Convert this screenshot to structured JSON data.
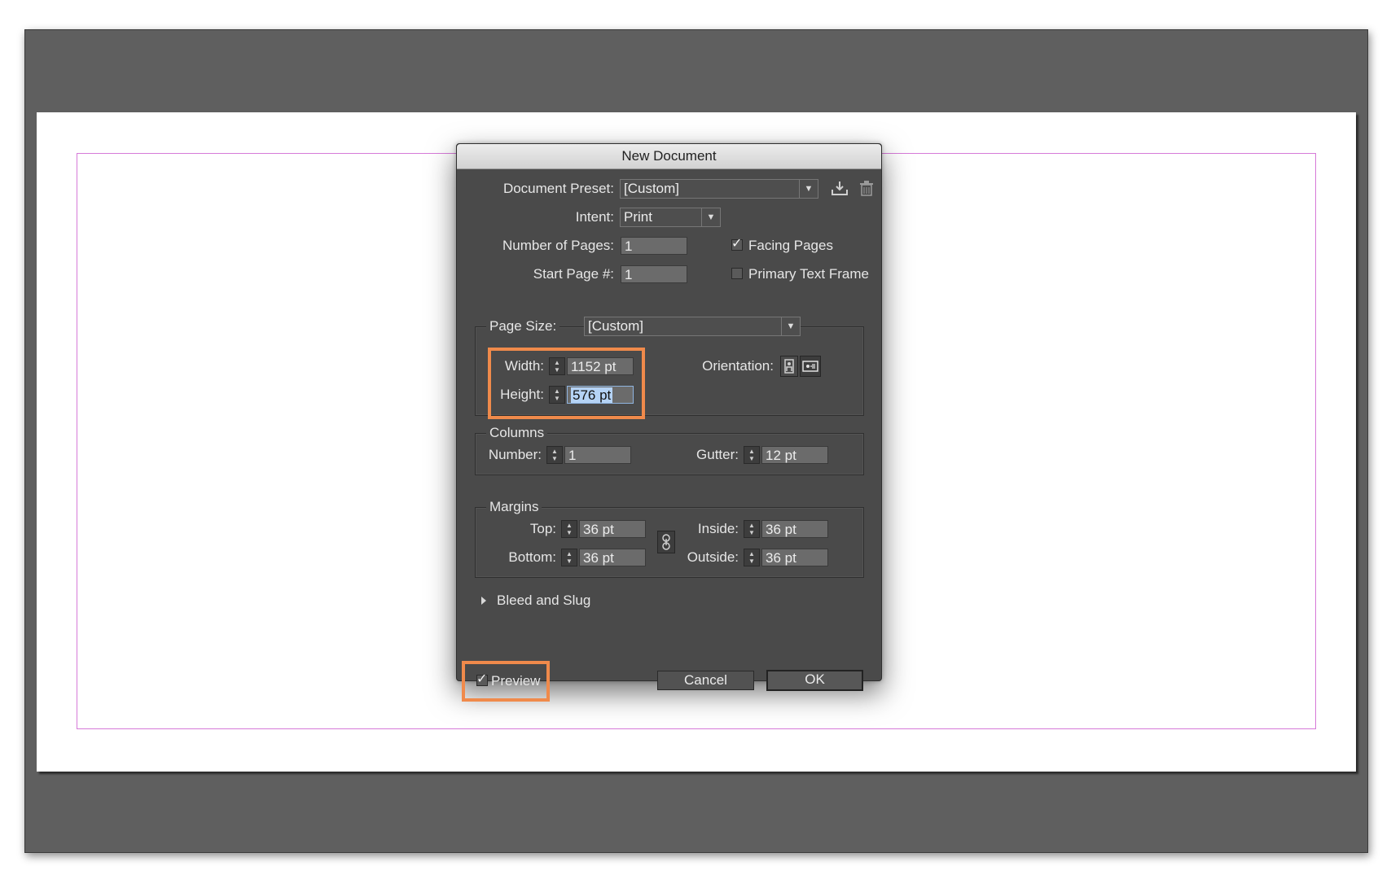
{
  "dialog": {
    "title": "New Document",
    "document_preset": {
      "label": "Document Preset:",
      "value": "[Custom]"
    },
    "intent": {
      "label": "Intent:",
      "value": "Print"
    },
    "number_of_pages": {
      "label": "Number of Pages:",
      "value": "1"
    },
    "start_page": {
      "label": "Start Page #:",
      "value": "1"
    },
    "facing_pages": {
      "label": "Facing Pages",
      "checked": true
    },
    "primary_text_frame": {
      "label": "Primary Text Frame",
      "checked": false
    },
    "page_size": {
      "label": "Page Size:",
      "value": "[Custom]",
      "width": {
        "label": "Width:",
        "value": "1152 pt"
      },
      "height": {
        "label": "Height:",
        "value": "576 pt"
      },
      "orientation_label": "Orientation:"
    },
    "columns": {
      "title": "Columns",
      "number": {
        "label": "Number:",
        "value": "1"
      },
      "gutter": {
        "label": "Gutter:",
        "value": "12 pt"
      }
    },
    "margins": {
      "title": "Margins",
      "top": {
        "label": "Top:",
        "value": "36 pt"
      },
      "bottom": {
        "label": "Bottom:",
        "value": "36 pt"
      },
      "inside": {
        "label": "Inside:",
        "value": "36 pt"
      },
      "outside": {
        "label": "Outside:",
        "value": "36 pt"
      }
    },
    "bleed_and_slug": "Bleed and Slug",
    "preview": {
      "label": "Preview",
      "checked": true
    },
    "cancel_label": "Cancel",
    "ok_label": "OK"
  },
  "icons": [
    "save-preset-icon",
    "delete-preset-icon",
    "portrait-icon",
    "landscape-icon",
    "link-icon",
    "disclosure-triangle-icon"
  ],
  "colors": {
    "pasteboard": "#5f5f5f",
    "dialog_bg": "#4a4a4a",
    "margin_guide": "#d67ad8",
    "highlight": "#f08a4b",
    "text_selection": "#b5d3f5"
  }
}
